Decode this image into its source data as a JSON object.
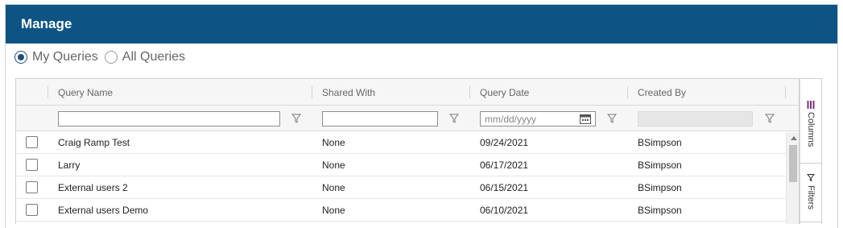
{
  "header": {
    "title": "Manage"
  },
  "query_scope": {
    "options": [
      {
        "label": "My Queries",
        "checked": true
      },
      {
        "label": "All Queries",
        "checked": false
      }
    ]
  },
  "grid": {
    "columns": [
      {
        "label": "Query Name"
      },
      {
        "label": "Shared With"
      },
      {
        "label": "Query Date"
      },
      {
        "label": "Created By"
      }
    ],
    "filters": {
      "query_name": "",
      "shared_with": "",
      "query_date_placeholder": "mm/dd/yyyy",
      "created_by": ""
    },
    "rows": [
      {
        "name": "Craig Ramp Test",
        "shared": "None",
        "date": "09/24/2021",
        "created_by": "BSimpson"
      },
      {
        "name": "Larry",
        "shared": "None",
        "date": "06/17/2021",
        "created_by": "BSimpson"
      },
      {
        "name": "External users 2",
        "shared": "None",
        "date": "06/15/2021",
        "created_by": "BSimpson"
      },
      {
        "name": "External users Demo",
        "shared": "None",
        "date": "06/10/2021",
        "created_by": "BSimpson"
      }
    ]
  },
  "side_panel": {
    "columns_label": "Columns",
    "filters_label": "Filters"
  },
  "colors": {
    "header_bg": "#0d5485",
    "radio_selected": "#1f4e79"
  },
  "icons": [
    "filter-funnel-icon",
    "calendar-icon",
    "columns-icon",
    "scroll-up-icon"
  ]
}
